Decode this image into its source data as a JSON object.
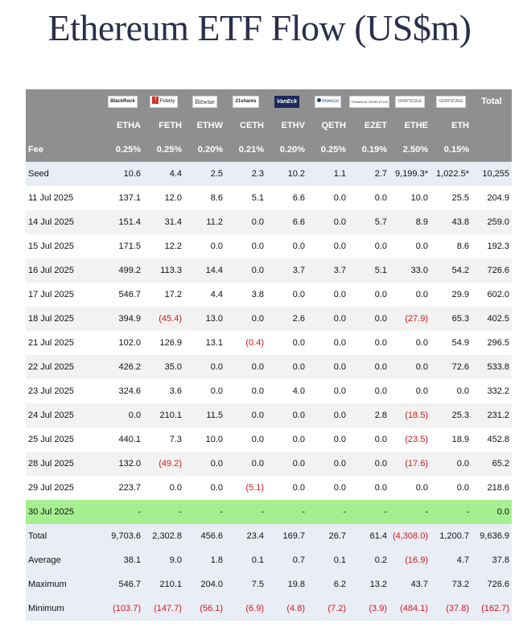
{
  "title": "Ethereum ETF Flow (US$m)",
  "chart_data": {
    "type": "table",
    "issuers": [
      {
        "logo_text": "BlackRock",
        "icon": "blackrock-logo",
        "ticker": "ETHA",
        "fee": "0.25%"
      },
      {
        "logo_text": "Fidelity",
        "icon": "fidelity-logo",
        "ticker": "FETH",
        "fee": "0.25%"
      },
      {
        "logo_text": "Bitwise",
        "icon": "bitwise-logo",
        "ticker": "ETHW",
        "fee": "0.20%"
      },
      {
        "logo_text": "21shares",
        "icon": "21shares-logo",
        "ticker": "CETH",
        "fee": "0.21%"
      },
      {
        "logo_text": "VanEck",
        "icon": "vaneck-logo",
        "ticker": "ETHV",
        "fee": "0.20%"
      },
      {
        "logo_text": "Invesco",
        "icon": "invesco-logo",
        "ticker": "QETH",
        "fee": "0.25%"
      },
      {
        "logo_text": "FRANKLIN TEMPLETON",
        "icon": "franklin-templeton-logo",
        "ticker": "EZET",
        "fee": "0.19%"
      },
      {
        "logo_text": "GRAYSCALE",
        "icon": "grayscale-logo",
        "ticker": "ETHE",
        "fee": "2.50%"
      },
      {
        "logo_text": "GRAYSCALE",
        "icon": "grayscale-logo",
        "ticker": "ETH",
        "fee": "0.15%"
      }
    ],
    "total_header": "Total",
    "fee_label": "Fee",
    "rows": [
      {
        "label": "Seed",
        "kind": "seed",
        "values": [
          "10.6",
          "4.4",
          "2.5",
          "2.3",
          "10.2",
          "1.1",
          "2.7",
          "9,199.3*",
          "1,022.5*"
        ],
        "total": "10,255"
      },
      {
        "label": "11 Jul 2025",
        "kind": "data",
        "values": [
          "137.1",
          "12.0",
          "8.6",
          "5.1",
          "6.6",
          "0.0",
          "0.0",
          "10.0",
          "25.5"
        ],
        "total": "204.9"
      },
      {
        "label": "14 Jul 2025",
        "kind": "data",
        "values": [
          "151.4",
          "31.4",
          "11.2",
          "0.0",
          "6.6",
          "0.0",
          "5.7",
          "8.9",
          "43.8"
        ],
        "total": "259.0"
      },
      {
        "label": "15 Jul 2025",
        "kind": "data",
        "values": [
          "171.5",
          "12.2",
          "0.0",
          "0.0",
          "0.0",
          "0.0",
          "0.0",
          "0.0",
          "8.6"
        ],
        "total": "192.3"
      },
      {
        "label": "16 Jul 2025",
        "kind": "data",
        "values": [
          "499.2",
          "113.3",
          "14.4",
          "0.0",
          "3.7",
          "3.7",
          "5.1",
          "33.0",
          "54.2"
        ],
        "total": "726.6"
      },
      {
        "label": "17 Jul 2025",
        "kind": "data",
        "values": [
          "546.7",
          "17.2",
          "4.4",
          "3.8",
          "0.0",
          "0.0",
          "0.0",
          "0.0",
          "29.9"
        ],
        "total": "602.0"
      },
      {
        "label": "18 Jul 2025",
        "kind": "data",
        "values": [
          "394.9",
          "(45.4)",
          "13.0",
          "0.0",
          "2.6",
          "0.0",
          "0.0",
          "(27.9)",
          "65.3"
        ],
        "total": "402.5"
      },
      {
        "label": "21 Jul 2025",
        "kind": "data",
        "values": [
          "102.0",
          "126.9",
          "13.1",
          "(0.4)",
          "0.0",
          "0.0",
          "0.0",
          "0.0",
          "54.9"
        ],
        "total": "296.5"
      },
      {
        "label": "22 Jul 2025",
        "kind": "data",
        "values": [
          "426.2",
          "35.0",
          "0.0",
          "0.0",
          "0.0",
          "0.0",
          "0.0",
          "0.0",
          "72.6"
        ],
        "total": "533.8"
      },
      {
        "label": "23 Jul 2025",
        "kind": "data",
        "values": [
          "324.6",
          "3.6",
          "0.0",
          "0.0",
          "4.0",
          "0.0",
          "0.0",
          "0.0",
          "0.0"
        ],
        "total": "332.2"
      },
      {
        "label": "24 Jul 2025",
        "kind": "data",
        "values": [
          "0.0",
          "210.1",
          "11.5",
          "0.0",
          "0.0",
          "0.0",
          "2.8",
          "(18.5)",
          "25.3"
        ],
        "total": "231.2"
      },
      {
        "label": "25 Jul 2025",
        "kind": "data",
        "values": [
          "440.1",
          "7.3",
          "10.0",
          "0.0",
          "0.0",
          "0.0",
          "0.0",
          "(23.5)",
          "18.9"
        ],
        "total": "452.8"
      },
      {
        "label": "28 Jul 2025",
        "kind": "data",
        "values": [
          "132.0",
          "(49.2)",
          "0.0",
          "0.0",
          "0.0",
          "0.0",
          "0.0",
          "(17.6)",
          "0.0"
        ],
        "total": "65.2"
      },
      {
        "label": "29 Jul 2025",
        "kind": "data",
        "values": [
          "223.7",
          "0.0",
          "0.0",
          "(5.1)",
          "0.0",
          "0.0",
          "0.0",
          "0.0",
          "0.0"
        ],
        "total": "218.6"
      },
      {
        "label": "30 Jul 2025",
        "kind": "today",
        "values": [
          "-",
          "-",
          "-",
          "-",
          "-",
          "-",
          "-",
          "-",
          "-"
        ],
        "total": "0.0"
      },
      {
        "label": "Total",
        "kind": "stat",
        "values": [
          "9,703.6",
          "2,302.8",
          "456.6",
          "23.4",
          "169.7",
          "26.7",
          "61.4",
          "(4,308.0)",
          "1,200.7"
        ],
        "total": "9,636.9"
      },
      {
        "label": "Average",
        "kind": "stat",
        "values": [
          "38.1",
          "9.0",
          "1.8",
          "0.1",
          "0.7",
          "0.1",
          "0.2",
          "(16.9)",
          "4.7"
        ],
        "total": "37.8"
      },
      {
        "label": "Maximum",
        "kind": "stat",
        "values": [
          "546.7",
          "210.1",
          "204.0",
          "7.5",
          "19.8",
          "6.2",
          "13.2",
          "43.7",
          "73.2"
        ],
        "total": "726.6"
      },
      {
        "label": "Minimum",
        "kind": "stat",
        "values": [
          "(103.7)",
          "(147.7)",
          "(56.1)",
          "(6.9)",
          "(4.8)",
          "(7.2)",
          "(3.9)",
          "(484.1)",
          "(37.8)"
        ],
        "total": "(162.7)"
      }
    ],
    "colors": {
      "header_bg": "#8f8f8f",
      "seed_stat_bg": "#e9edf6",
      "alt_row_bg": "#f2f2f2",
      "today_bg": "#a6ef91",
      "negative": "#d11a1a"
    }
  }
}
